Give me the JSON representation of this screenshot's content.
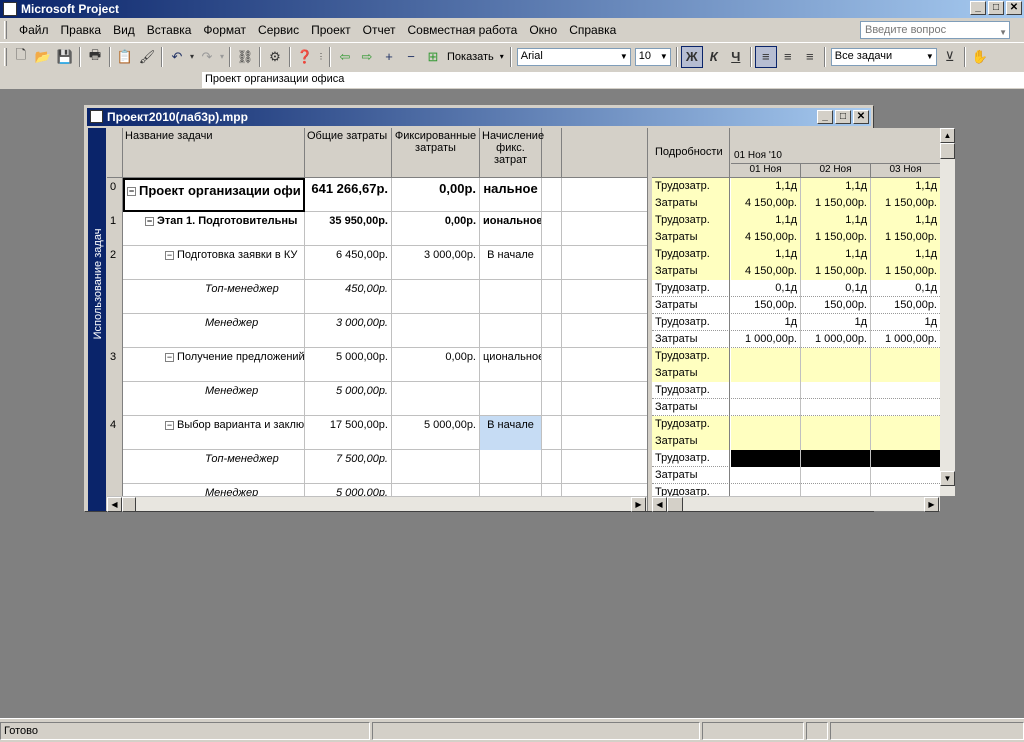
{
  "app": {
    "title": "Microsoft Project"
  },
  "window_buttons": {
    "minimize": "_",
    "maximize": "□",
    "close": "✕"
  },
  "menu": [
    "Файл",
    "Правка",
    "Вид",
    "Вставка",
    "Формат",
    "Сервис",
    "Проект",
    "Отчет",
    "Совместная работа",
    "Окно",
    "Справка"
  ],
  "ask": {
    "placeholder": "Введите вопрос"
  },
  "toolbar": {
    "show_label": "Показать",
    "font": "Arial",
    "font_size": "10",
    "bold": "Ж",
    "italic": "К",
    "underline": "Ч",
    "filter": "Все задачи"
  },
  "entry": {
    "value": "Проект организации офиса"
  },
  "document": {
    "title": "Проект2010(лаб3р).mpp",
    "view_name": "Использование задач"
  },
  "grid": {
    "headers": [
      "Название задачи",
      "Общие затраты",
      "Фиксированные затраты",
      "Начисление фикс. затрат"
    ],
    "rows": [
      {
        "id": "0",
        "name": "Проект организации офи",
        "total": "641 266,67р.",
        "fixed": "0,00р.",
        "accrual": "нальное",
        "level": 0,
        "style": "big-bold",
        "collapse": true
      },
      {
        "id": "1",
        "name": "Этап 1. Подготовительны",
        "total": "35 950,00р.",
        "fixed": "0,00р.",
        "accrual": "иональное",
        "level": 1,
        "style": "bold",
        "collapse": true
      },
      {
        "id": "2",
        "name": "Подготовка заявки в КУ",
        "total": "6 450,00р.",
        "fixed": "3 000,00р.",
        "accrual": "В начале",
        "level": 2,
        "style": "normal",
        "collapse": true
      },
      {
        "id": "",
        "name": "Топ-менеджер",
        "total": "450,00р.",
        "fixed": "",
        "accrual": "",
        "level": 3,
        "style": "italic",
        "collapse": false
      },
      {
        "id": "",
        "name": "Менеджер",
        "total": "3 000,00р.",
        "fixed": "",
        "accrual": "",
        "level": 3,
        "style": "italic",
        "collapse": false
      },
      {
        "id": "3",
        "name": "Получение предложений",
        "total": "5 000,00р.",
        "fixed": "0,00р.",
        "accrual": "циональное",
        "level": 2,
        "style": "normal",
        "collapse": true
      },
      {
        "id": "",
        "name": "Менеджер",
        "total": "5 000,00р.",
        "fixed": "",
        "accrual": "",
        "level": 3,
        "style": "italic",
        "collapse": false
      },
      {
        "id": "4",
        "name": "Выбор варианта и заклю",
        "total": "17 500,00р.",
        "fixed": "5 000,00р.",
        "accrual": "В начале",
        "level": 2,
        "style": "normal",
        "collapse": true
      },
      {
        "id": "",
        "name": "Топ-менеджер",
        "total": "7 500,00р.",
        "fixed": "",
        "accrual": "",
        "level": 3,
        "style": "italic",
        "collapse": false
      },
      {
        "id": "",
        "name": "Менеджер",
        "total": "5 000,00р.",
        "fixed": "",
        "accrual": "",
        "level": 3,
        "style": "italic",
        "collapse": false
      }
    ]
  },
  "timeline": {
    "details_label": "Подробности",
    "week": "01 Ноя '10",
    "days": [
      "01 Ноя",
      "02 Ноя",
      "03 Ноя"
    ],
    "rows": [
      {
        "label": "Трудозатр.",
        "values": [
          "1,1д",
          "1,1д",
          "1,1д"
        ],
        "bg": "yellow"
      },
      {
        "label": "Затраты",
        "values": [
          "4 150,00р.",
          "1 150,00р.",
          "1 150,00р."
        ],
        "bg": "yellow"
      },
      {
        "label": "Трудозатр.",
        "values": [
          "1,1д",
          "1,1д",
          "1,1д"
        ],
        "bg": "yellow"
      },
      {
        "label": "Затраты",
        "values": [
          "4 150,00р.",
          "1 150,00р.",
          "1 150,00р."
        ],
        "bg": "yellow"
      },
      {
        "label": "Трудозатр.",
        "values": [
          "1,1д",
          "1,1д",
          "1,1д"
        ],
        "bg": "yellow"
      },
      {
        "label": "Затраты",
        "values": [
          "4 150,00р.",
          "1 150,00р.",
          "1 150,00р."
        ],
        "bg": "yellow"
      },
      {
        "label": "Трудозатр.",
        "values": [
          "0,1д",
          "0,1д",
          "0,1д"
        ],
        "bg": "white"
      },
      {
        "label": "Затраты",
        "values": [
          "150,00р.",
          "150,00р.",
          "150,00р."
        ],
        "bg": "white"
      },
      {
        "label": "Трудозатр.",
        "values": [
          "1д",
          "1д",
          "1д"
        ],
        "bg": "white"
      },
      {
        "label": "Затраты",
        "values": [
          "1 000,00р.",
          "1 000,00р.",
          "1 000,00р."
        ],
        "bg": "white"
      },
      {
        "label": "Трудозатр.",
        "values": [
          "",
          "",
          ""
        ],
        "bg": "yellow"
      },
      {
        "label": "Затраты",
        "values": [
          "",
          "",
          ""
        ],
        "bg": "yellow"
      },
      {
        "label": "Трудозатр.",
        "values": [
          "",
          "",
          ""
        ],
        "bg": "white"
      },
      {
        "label": "Затраты",
        "values": [
          "",
          "",
          ""
        ],
        "bg": "white"
      },
      {
        "label": "Трудозатр.",
        "values": [
          "",
          "",
          ""
        ],
        "bg": "yellow"
      },
      {
        "label": "Затраты",
        "values": [
          "",
          "",
          ""
        ],
        "bg": "yellow"
      },
      {
        "label": "Трудозатр.",
        "values": [
          "",
          "",
          ""
        ],
        "bg": "black"
      },
      {
        "label": "Затраты",
        "values": [
          "",
          "",
          ""
        ],
        "bg": "white"
      },
      {
        "label": "Трудозатр.",
        "values": [
          "",
          "",
          ""
        ],
        "bg": "white"
      }
    ]
  },
  "status": {
    "text": "Готово"
  }
}
